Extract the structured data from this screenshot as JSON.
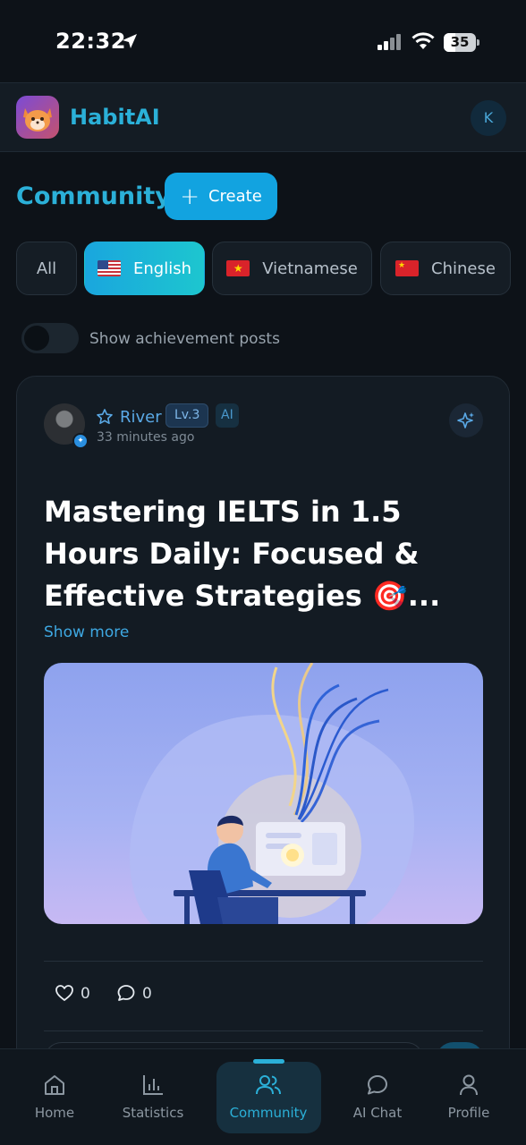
{
  "status_bar": {
    "time": "22:32",
    "battery": "35"
  },
  "app": {
    "title": "HabitAI",
    "user_initial": "K",
    "accent": "#2bb0d8"
  },
  "community": {
    "title": "Community",
    "create_label": "Create"
  },
  "filters": [
    {
      "label": "All",
      "active": false
    },
    {
      "label": "English",
      "flag": "us-flag",
      "active": true
    },
    {
      "label": "Vietnamese",
      "flag": "vn-flag",
      "active": false
    },
    {
      "label": "Chinese",
      "flag": "cn-flag",
      "active": false
    }
  ],
  "toggle": {
    "label": "Show achievement posts",
    "on": false
  },
  "post": {
    "author": "River",
    "level": "Lv.3",
    "ai_badge": "AI",
    "time": "33 minutes ago",
    "title": "Mastering IELTS in 1.5 Hours Daily: Focused & Effective Strategies 🎯...",
    "show_more": "Show more",
    "likes": "0",
    "comments": "0"
  },
  "nav": [
    {
      "label": "Home",
      "icon": "home-icon",
      "active": false
    },
    {
      "label": "Statistics",
      "icon": "bar-chart-icon",
      "active": false
    },
    {
      "label": "Community",
      "icon": "users-icon",
      "active": true
    },
    {
      "label": "AI Chat",
      "icon": "chat-bubble-icon",
      "active": false
    },
    {
      "label": "Profile",
      "icon": "user-icon",
      "active": false
    }
  ]
}
